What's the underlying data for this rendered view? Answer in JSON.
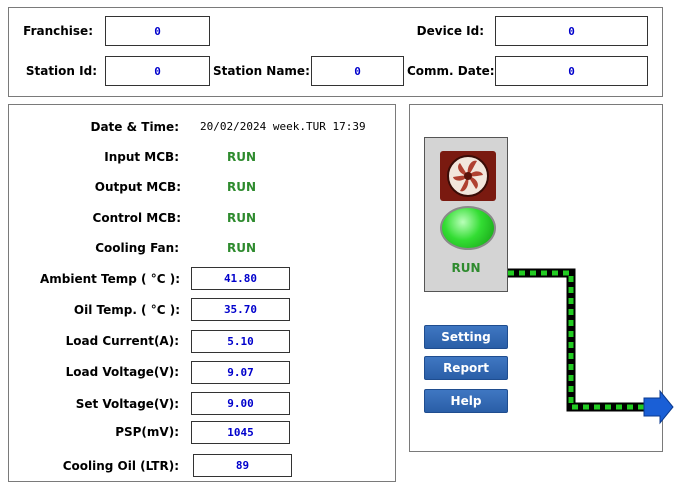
{
  "header": {
    "franchise_label": "Franchise:",
    "franchise_value": "0",
    "device_id_label": "Device Id:",
    "device_id_value": "0",
    "station_id_label": "Station Id:",
    "station_id_value": "0",
    "station_name_label": "Station Name:",
    "station_name_value": "0",
    "comm_date_label": "Comm. Date:",
    "comm_date_value": "0"
  },
  "status": {
    "datetime_label": "Date & Time:",
    "datetime_value": "20/02/2024 week.TUR 17:39",
    "input_mcb_label": "Input MCB:",
    "input_mcb_value": "RUN",
    "output_mcb_label": "Output MCB:",
    "output_mcb_value": "RUN",
    "control_mcb_label": "Control MCB:",
    "control_mcb_value": "RUN",
    "cooling_fan_label": "Cooling Fan:",
    "cooling_fan_value": "RUN"
  },
  "readings": {
    "ambient_temp_label": "Ambient Temp ( °C ):",
    "ambient_temp_value": "41.80",
    "oil_temp_label": "Oil Temp. ( °C ):",
    "oil_temp_value": "35.70",
    "load_current_label": "Load Current(A):",
    "load_current_value": "5.10",
    "load_voltage_label": "Load Voltage(V):",
    "load_voltage_value": "9.07",
    "set_voltage_label": "Set Voltage(V):",
    "set_voltage_value": "9.00",
    "psp_label": "PSP(mV):",
    "psp_value": "1045",
    "cooling_oil_label": "Cooling Oil (LTR):",
    "cooling_oil_value": "89"
  },
  "device": {
    "status_text": "RUN",
    "fan_icon": "fan-icon",
    "indicator_color": "#33dd33"
  },
  "buttons": {
    "setting": "Setting",
    "report": "Report",
    "help": "Help"
  }
}
